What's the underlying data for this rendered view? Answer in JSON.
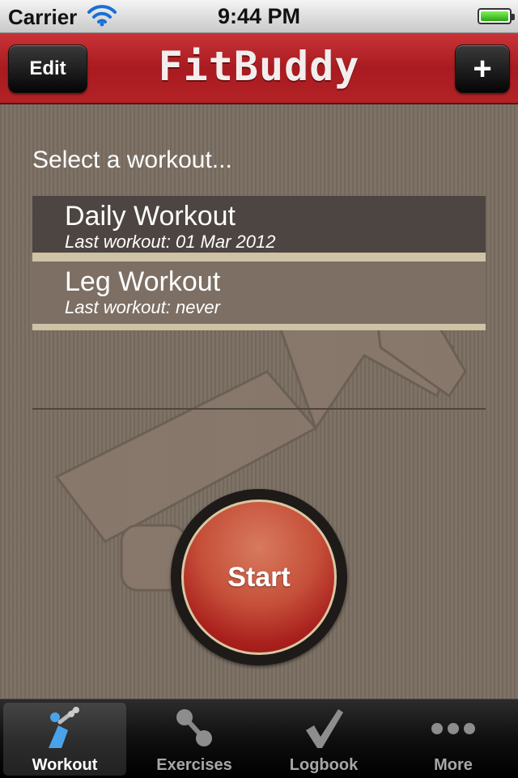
{
  "status_bar": {
    "carrier": "Carrier",
    "time": "9:44 PM"
  },
  "nav_bar": {
    "edit_label": "Edit",
    "title": "FitBuddy",
    "add_label": "+"
  },
  "main": {
    "prompt": "Select a workout...",
    "workouts": [
      {
        "title": "Daily Workout",
        "subtitle": "Last workout:  01 Mar 2012",
        "selected": true
      },
      {
        "title": "Leg Workout",
        "subtitle": "Last workout:  never",
        "selected": false
      }
    ],
    "start_label": "Start"
  },
  "tab_bar": {
    "tabs": [
      {
        "label": "Workout",
        "icon": "workout-figure-icon",
        "active": true
      },
      {
        "label": "Exercises",
        "icon": "dumbbell-icon",
        "active": false
      },
      {
        "label": "Logbook",
        "icon": "checkmark-icon",
        "active": false
      },
      {
        "label": "More",
        "icon": "more-dots-icon",
        "active": false
      }
    ]
  },
  "colors": {
    "nav_red": "#b32226",
    "background": "#7a6e62",
    "selected_row": "#4d4541",
    "row_border": "#cfc3a6",
    "start_red": "#a9201d"
  }
}
